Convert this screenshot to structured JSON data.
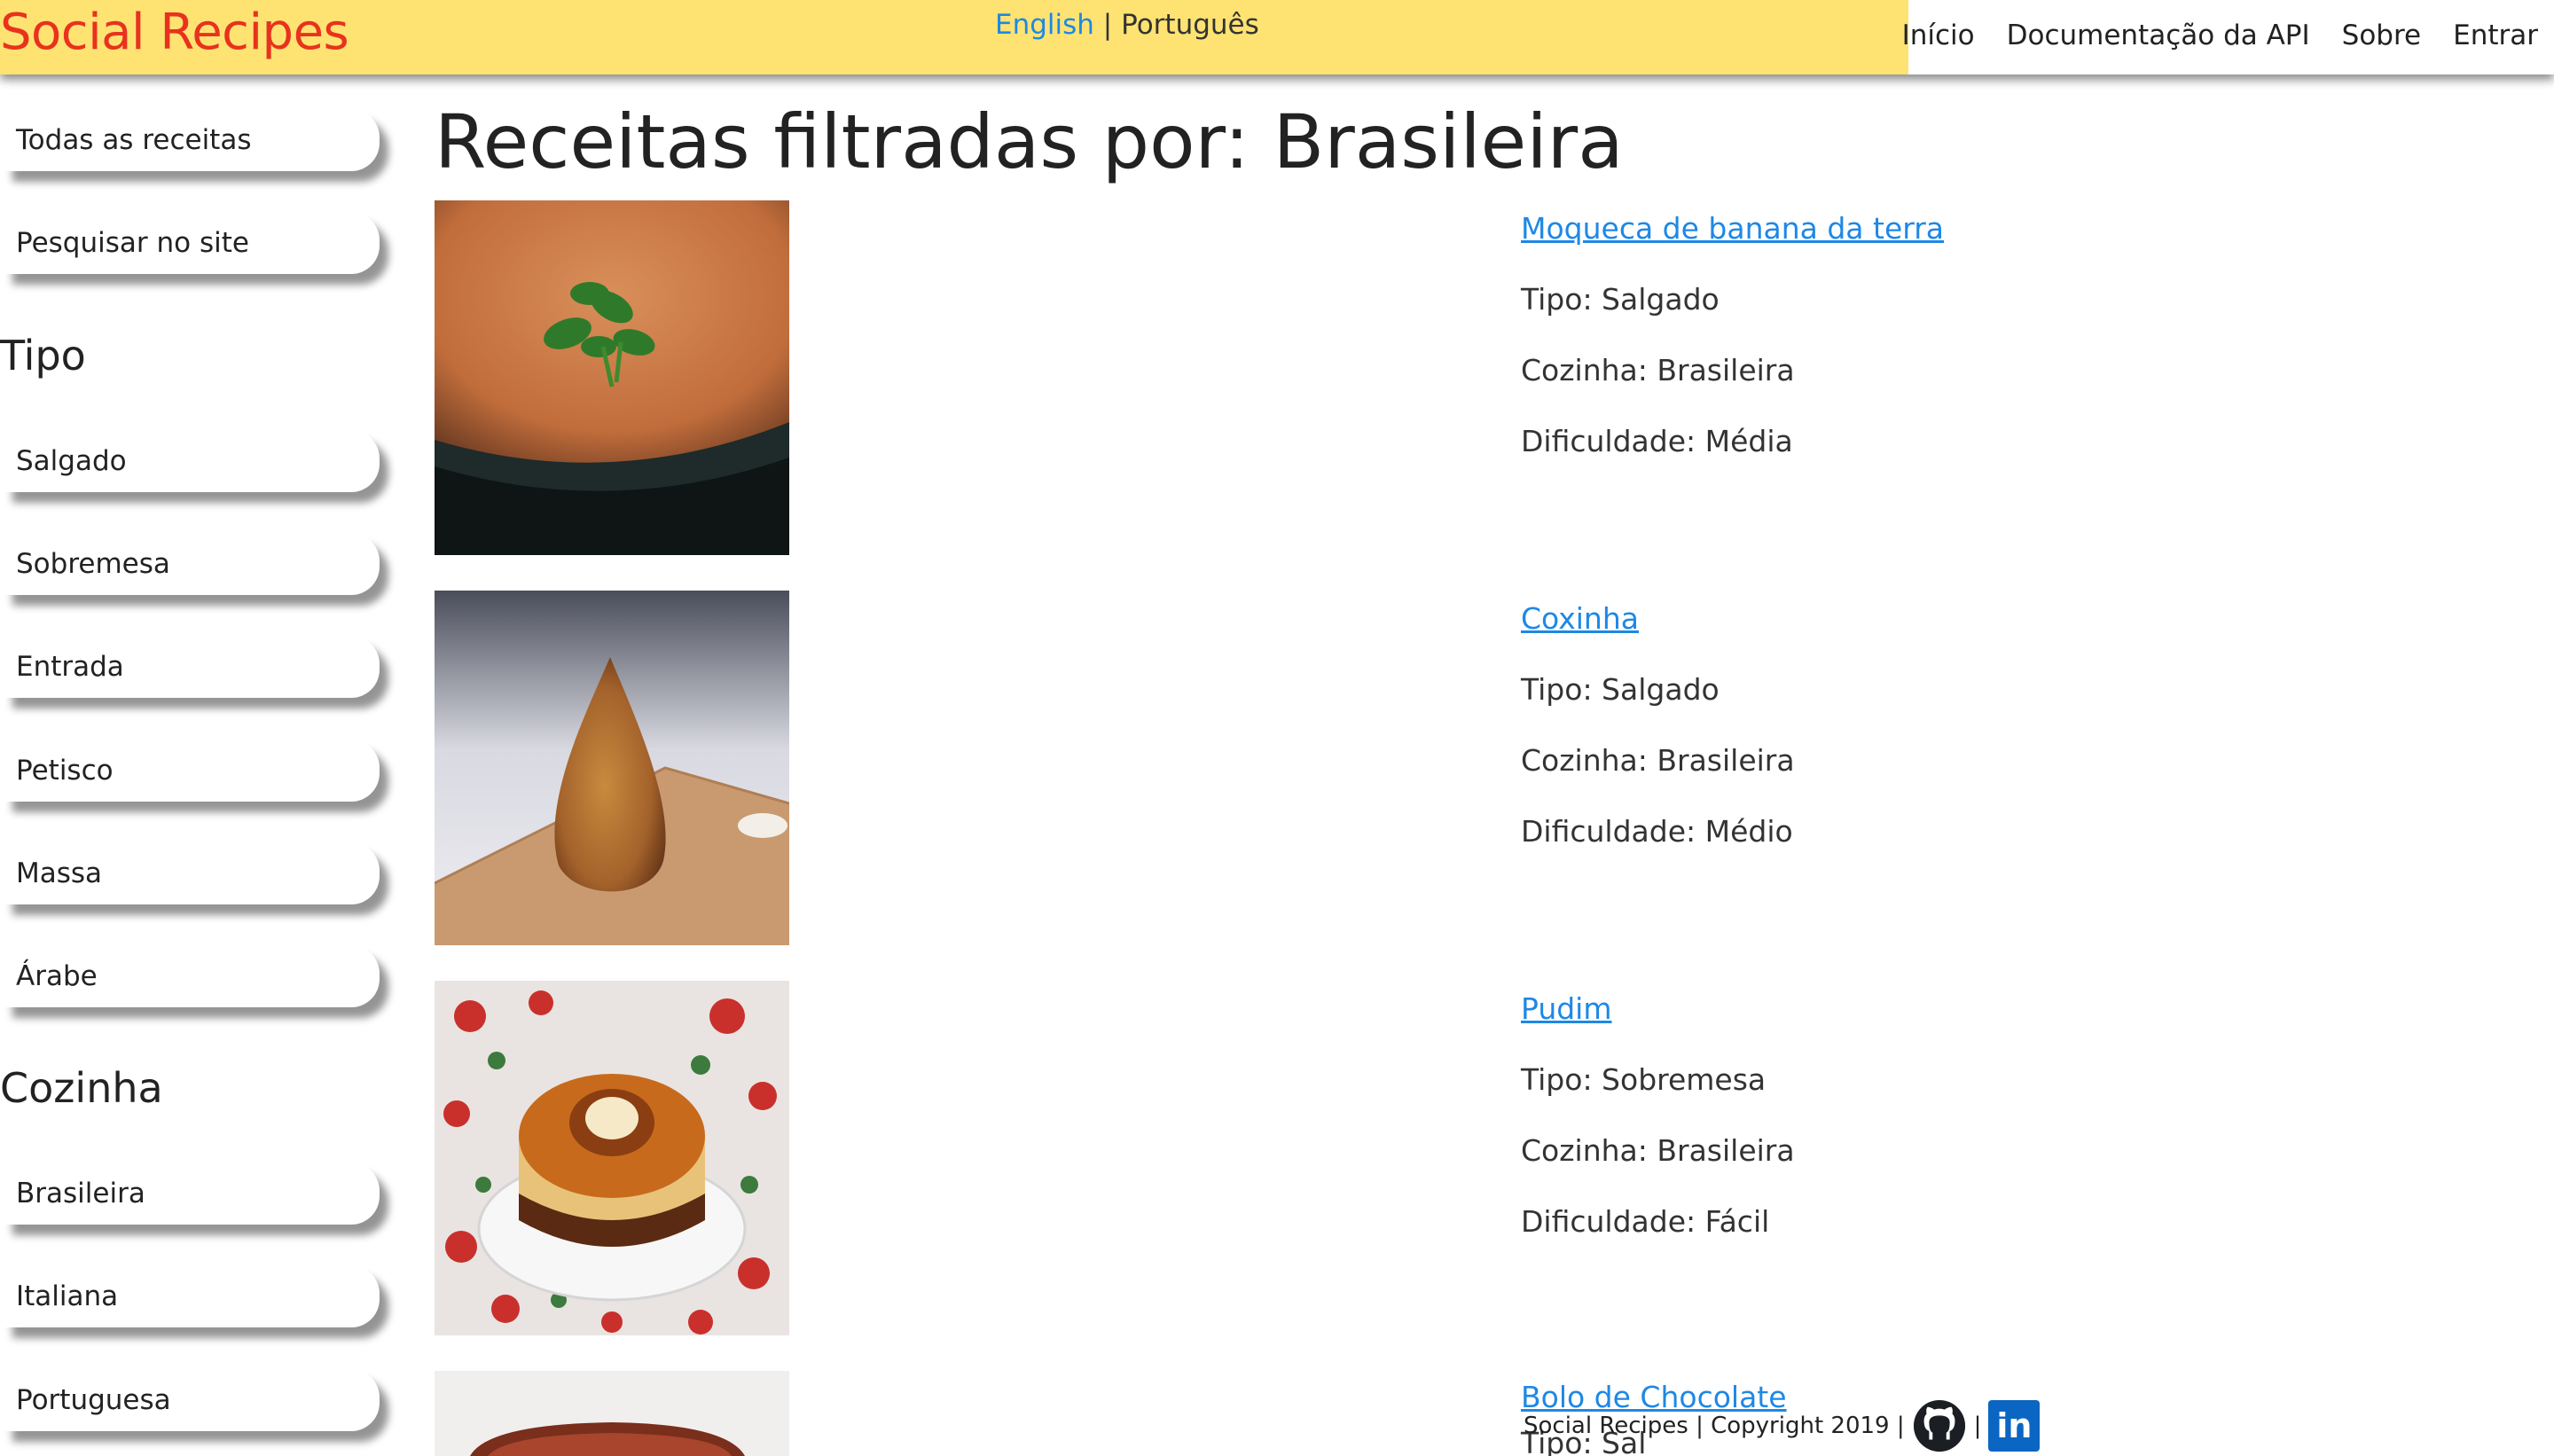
{
  "header": {
    "brand": "Social Recipes",
    "lang_en": "English",
    "lang_sep": "|",
    "lang_pt": "Português",
    "nav": [
      "Início",
      "Documentação da API",
      "Sobre",
      "Entrar"
    ]
  },
  "sidebar": {
    "all_recipes": "Todas as receitas",
    "search": "Pesquisar no site",
    "tipo_heading": "Tipo",
    "tipos": [
      "Salgado",
      "Sobremesa",
      "Entrada",
      "Petisco",
      "Massa",
      "Árabe"
    ],
    "cozinha_heading": "Cozinha",
    "cozinhas": [
      "Brasileira",
      "Italiana",
      "Portuguesa"
    ]
  },
  "main": {
    "title": "Receitas filtradas por: Brasileira",
    "recipes": [
      {
        "name": "Moqueca de banana da terra",
        "tipo": "Tipo: Salgado",
        "cozinha": "Cozinha: Brasileira",
        "dificuldade": "Dificuldade: Média"
      },
      {
        "name": "Coxinha",
        "tipo": "Tipo: Salgado",
        "cozinha": "Cozinha: Brasileira",
        "dificuldade": "Dificuldade: Médio"
      },
      {
        "name": "Pudim",
        "tipo": "Tipo: Sobremesa",
        "cozinha": "Cozinha: Brasileira",
        "dificuldade": "Dificuldade: Fácil"
      },
      {
        "name": "Bolo de Chocolate",
        "tipo": "Tipo: Sal"
      }
    ]
  },
  "footer": {
    "text": "Social Recipes | Copyright 2019 |",
    "sep": "|",
    "linkedin": "in"
  },
  "colors": {
    "brand_band": "#fee372",
    "brand_text": "#e8321e",
    "link": "#1e88e5",
    "linkedin": "#0a66c2"
  }
}
